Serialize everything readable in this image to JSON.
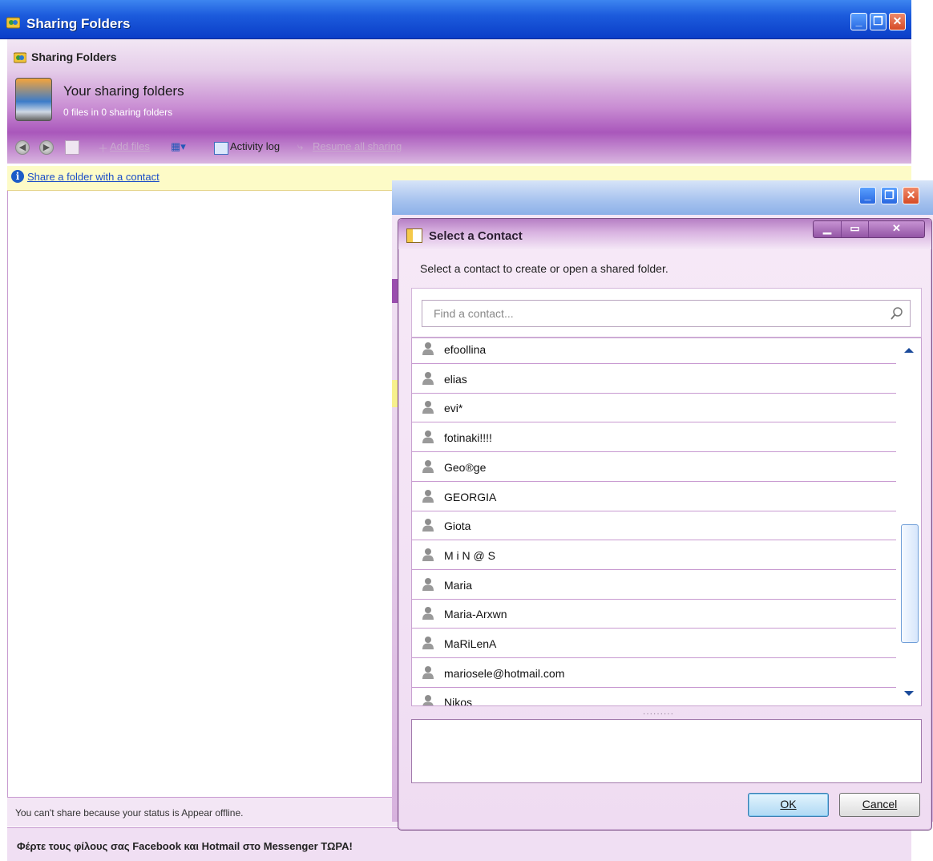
{
  "main_window": {
    "title": "Sharing Folders",
    "header_label": "Sharing Folders",
    "heading": "Your sharing folders",
    "subheading": "0 files in 0 sharing folders"
  },
  "toolbar": {
    "add_files": "Add files",
    "activity_log": "Activity log",
    "resume_all": "Resume all sharing"
  },
  "info_bar": {
    "link": "Share a folder with a contact"
  },
  "status_bar": {
    "text": "You can't share because your status is Appear offline."
  },
  "promo_bar": {
    "text": "Φέρτε τους φίλους σας Facebook και Hotmail στο Messenger ΤΩΡΑ!"
  },
  "dialog": {
    "title": "Select a Contact",
    "subtitle": "Select a contact to create or open a shared folder.",
    "search_placeholder": "Find a contact...",
    "ok_label": "OK",
    "cancel_label": "Cancel",
    "contacts": [
      "efoollina",
      "elias",
      "evi*",
      "fotinaki!!!!",
      "Geo®ge",
      "GEORGIA",
      "Giota",
      "M i N @ S",
      "Maria",
      "Maria-Arxwn",
      "MaRiLenA",
      "mariosele@hotmail.com",
      "Nikos"
    ],
    "scroll_position": 0.62
  },
  "icons": {
    "window": "sharing-folders-icon",
    "search": "search-icon",
    "contact": "contact-avatar-icon",
    "info": "info-icon"
  }
}
